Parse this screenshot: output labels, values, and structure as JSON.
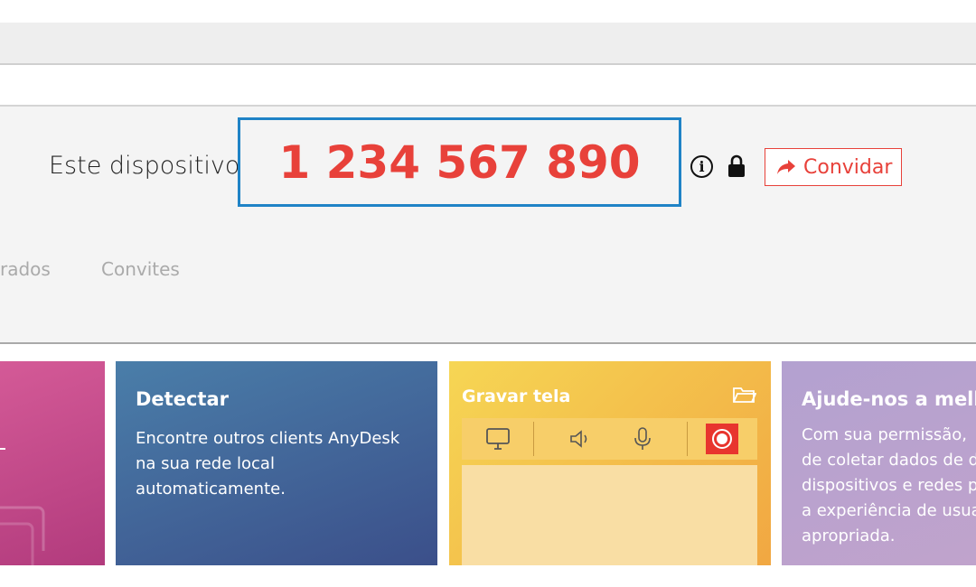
{
  "device": {
    "label": "Este dispositivo",
    "id": "1 234 567 890",
    "invite_label": "Convidar"
  },
  "tabs": [
    {
      "label": "rados"
    },
    {
      "label": "Convites"
    }
  ],
  "cards": {
    "detect": {
      "title": "Detectar",
      "lines": [
        "Encontre outros clients AnyDesk",
        "na sua rede local",
        "automaticamente."
      ]
    },
    "record": {
      "title": "Gravar tela"
    },
    "help": {
      "title": "Ajude-nos a mell",
      "lines": [
        "Com sua permissão,",
        "de coletar dados de d",
        "dispositivos e redes p",
        "a experiência de usua",
        "apropriada."
      ]
    }
  },
  "colors": {
    "accent_red": "#e8413a",
    "id_border_blue": "#1f83c6"
  },
  "icons": [
    "info-icon",
    "lock-icon",
    "share-icon",
    "folder-icon",
    "monitor-icon",
    "speaker-icon",
    "microphone-icon",
    "record-icon"
  ]
}
